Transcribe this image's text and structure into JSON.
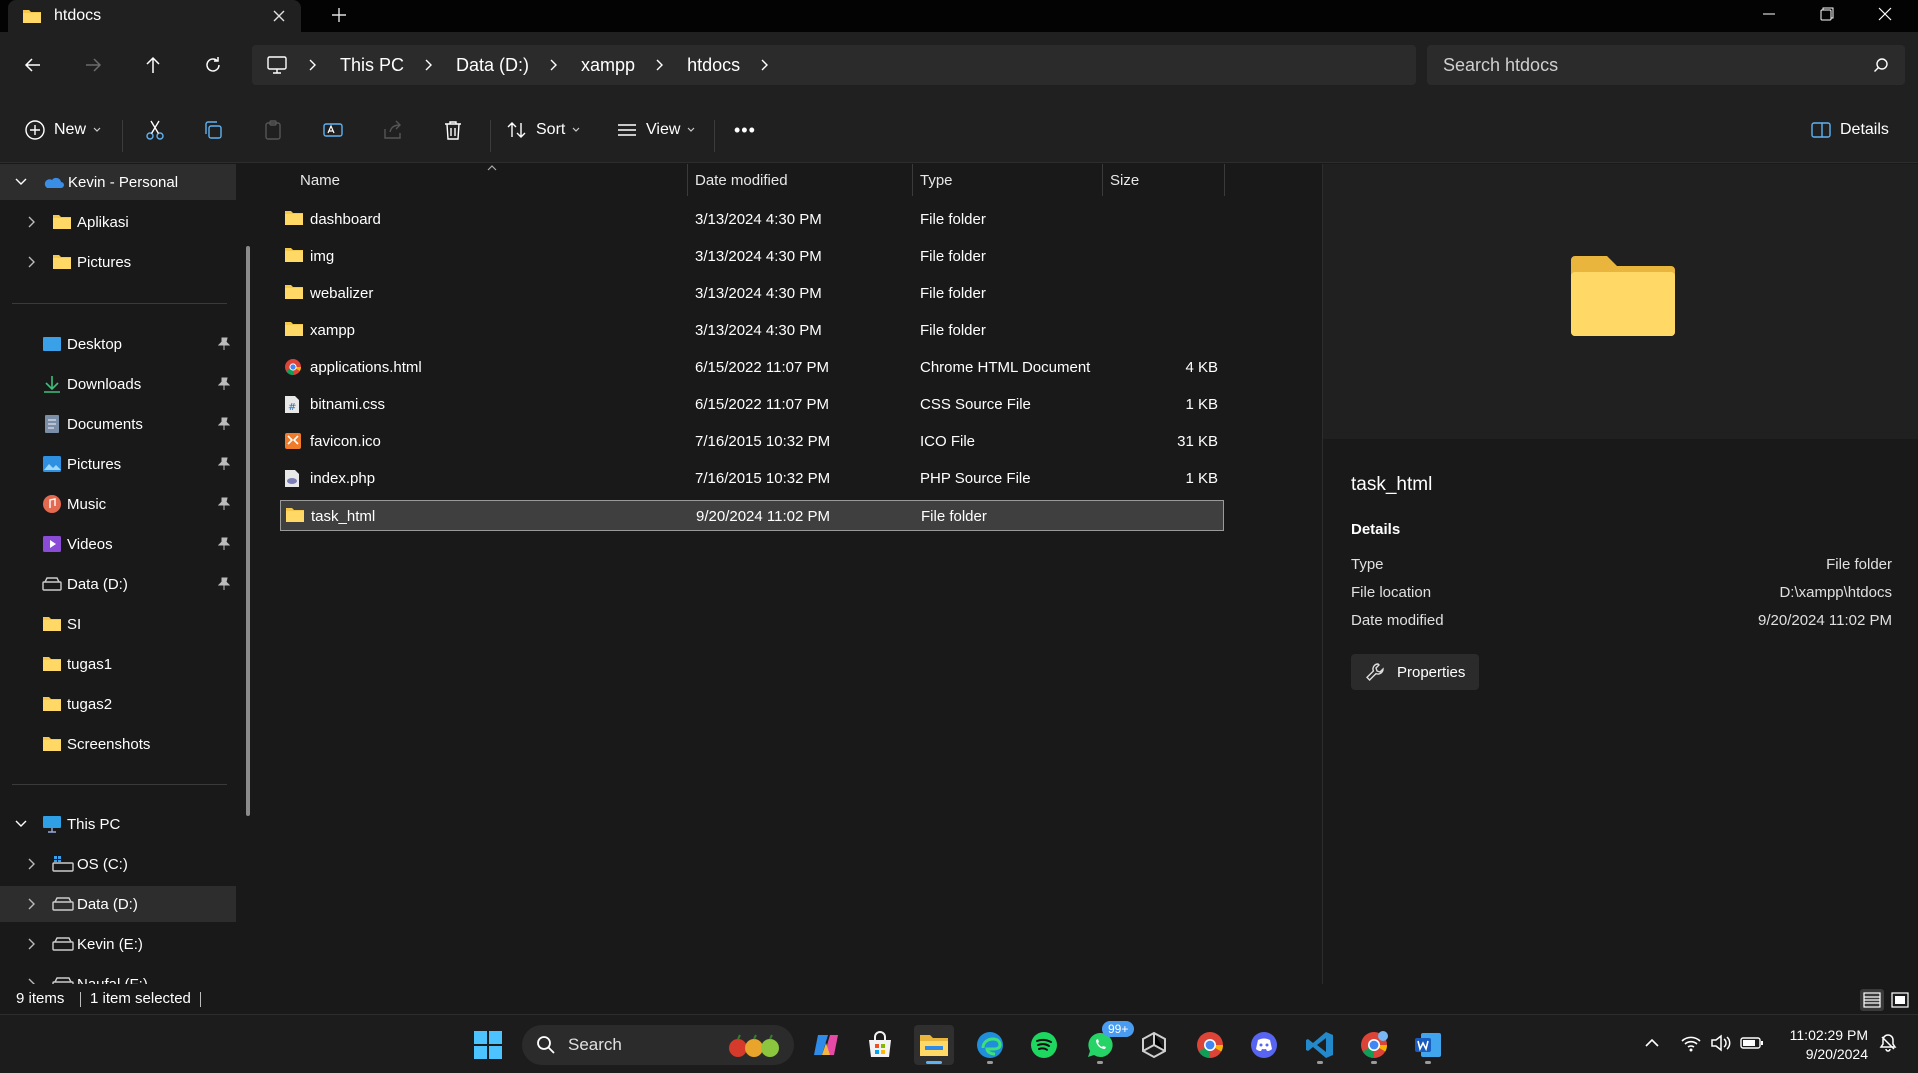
{
  "window": {
    "tab_title": "htdocs",
    "new_tab_label": "+"
  },
  "address": {
    "crumbs": [
      "This PC",
      "Data (D:)",
      "xampp",
      "htdocs"
    ],
    "search_placeholder": "Search htdocs"
  },
  "toolbar": {
    "new_label": "New",
    "sort_label": "Sort",
    "view_label": "View",
    "more_label": "•••",
    "details_label": "Details"
  },
  "sidebar": {
    "onedrive": {
      "label": "Kevin - Personal",
      "children": [
        "Aplikasi",
        "Pictures"
      ]
    },
    "quick_access": [
      {
        "label": "Desktop",
        "icon": "desktop-icon",
        "pinned": true
      },
      {
        "label": "Downloads",
        "icon": "download-icon",
        "pinned": true
      },
      {
        "label": "Documents",
        "icon": "document-icon",
        "pinned": true
      },
      {
        "label": "Pictures",
        "icon": "pictures-icon",
        "pinned": true
      },
      {
        "label": "Music",
        "icon": "music-icon",
        "pinned": true
      },
      {
        "label": "Videos",
        "icon": "videos-icon",
        "pinned": true
      },
      {
        "label": "Data (D:)",
        "icon": "drive-icon",
        "pinned": true
      },
      {
        "label": "SI",
        "icon": "folder-icon",
        "pinned": false
      },
      {
        "label": "tugas1",
        "icon": "folder-icon",
        "pinned": false
      },
      {
        "label": "tugas2",
        "icon": "folder-icon",
        "pinned": false
      },
      {
        "label": "Screenshots",
        "icon": "folder-icon",
        "pinned": false
      }
    ],
    "this_pc": {
      "label": "This PC",
      "drives": [
        "OS (C:)",
        "Data (D:)",
        "Kevin (E:)",
        "Naufal (F:)"
      ]
    }
  },
  "columns": {
    "name": "Name",
    "date": "Date modified",
    "type": "Type",
    "size": "Size"
  },
  "files": [
    {
      "name": "dashboard",
      "date": "3/13/2024 4:30 PM",
      "type": "File folder",
      "size": "",
      "icon": "folder-icon"
    },
    {
      "name": "img",
      "date": "3/13/2024 4:30 PM",
      "type": "File folder",
      "size": "",
      "icon": "folder-icon"
    },
    {
      "name": "webalizer",
      "date": "3/13/2024 4:30 PM",
      "type": "File folder",
      "size": "",
      "icon": "folder-icon"
    },
    {
      "name": "xampp",
      "date": "3/13/2024 4:30 PM",
      "type": "File folder",
      "size": "",
      "icon": "folder-icon"
    },
    {
      "name": "applications.html",
      "date": "6/15/2022 11:07 PM",
      "type": "Chrome HTML Document",
      "size": "4 KB",
      "icon": "chrome-file-icon"
    },
    {
      "name": "bitnami.css",
      "date": "6/15/2022 11:07 PM",
      "type": "CSS Source File",
      "size": "1 KB",
      "icon": "css-file-icon"
    },
    {
      "name": "favicon.ico",
      "date": "7/16/2015 10:32 PM",
      "type": "ICO File",
      "size": "31 KB",
      "icon": "ico-file-icon"
    },
    {
      "name": "index.php",
      "date": "7/16/2015 10:32 PM",
      "type": "PHP Source File",
      "size": "1 KB",
      "icon": "php-file-icon"
    },
    {
      "name": "task_html",
      "date": "9/20/2024 11:02 PM",
      "type": "File folder",
      "size": "",
      "icon": "folder-icon",
      "selected": true
    }
  ],
  "details_pane": {
    "title": "task_html",
    "section": "Details",
    "rows": [
      {
        "key": "Type",
        "value": "File folder"
      },
      {
        "key": "File location",
        "value": "D:\\xampp\\htdocs"
      },
      {
        "key": "Date modified",
        "value": "9/20/2024 11:02 PM"
      }
    ],
    "properties_label": "Properties"
  },
  "status": {
    "items_count": "9 items",
    "selected": "1 item selected"
  },
  "taskbar": {
    "search_label": "Search",
    "whatsapp_badge": "99+",
    "time": "11:02:29 PM",
    "date": "9/20/2024"
  },
  "colors": {
    "folder": "#f5c84c",
    "accent": "#5fb2f2",
    "onedrive": "#3a8ee6"
  }
}
